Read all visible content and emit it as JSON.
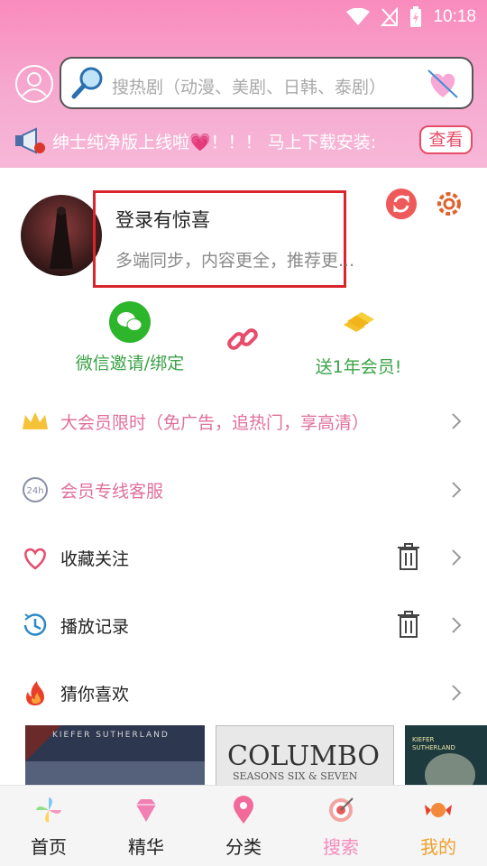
{
  "status": {
    "time": "10:18"
  },
  "search": {
    "placeholder": "搜热剧（动漫、美剧、日韩、泰剧）"
  },
  "notice": {
    "text": "绅士纯净版上线啦💗！！！  马上下载安装:",
    "button": "查看"
  },
  "profile": {
    "title": "登录有惊喜",
    "subtitle": "多端同步，内容更全，推荐更..."
  },
  "actions": {
    "invite": "微信邀请/绑定",
    "gift": "送1年会员!"
  },
  "menu": {
    "vip": "大会员限时（免广告，追热门，享高清）",
    "service": "会员专线客服",
    "favorites": "收藏关注",
    "history": "播放记录",
    "recommend": "猜你喜欢"
  },
  "posters": {
    "p1_text": "KIEFER SUTHERLAND",
    "p2_title": "COLUMBO",
    "p2_sub": "SEASONS SIX & SEVEN",
    "p3_text": "KIEFER SUTHERLAND"
  },
  "tabs": [
    {
      "label": "首页",
      "color": "#222222"
    },
    {
      "label": "精华",
      "color": "#222222"
    },
    {
      "label": "分类",
      "color": "#222222"
    },
    {
      "label": "搜索",
      "color": "#f58bbd"
    },
    {
      "label": "我的",
      "color": "#f0a02a"
    }
  ],
  "colors": {
    "accent_pink": "#f98bbd",
    "red_box": "#d9262c",
    "green": "#3aa246",
    "vip_text": "#e0709a",
    "service_text": "#e0709a"
  }
}
